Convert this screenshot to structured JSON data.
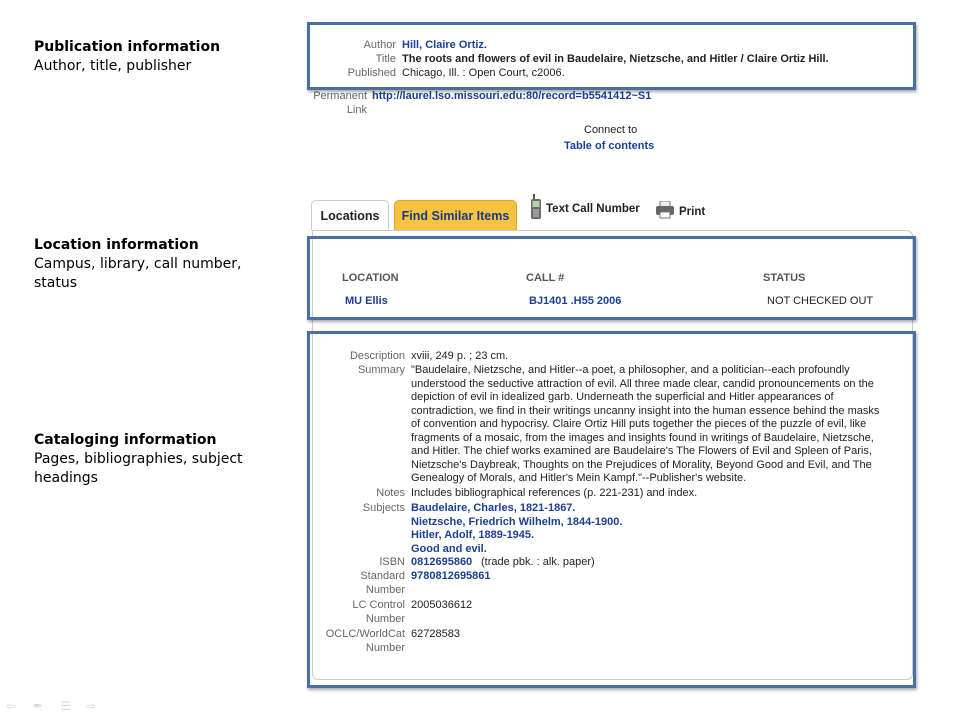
{
  "annotations": [
    {
      "heading": "Publication information",
      "text": "Author, title, publisher"
    },
    {
      "heading": "Location information",
      "text": "Campus, library, call number, status"
    },
    {
      "heading": "Cataloging information",
      "text": "Pages, bibliographies, subject headings"
    }
  ],
  "record": {
    "author_label": "Author",
    "author": "Hill, Claire Ortiz.",
    "title_label": "Title",
    "title": "The roots and flowers of evil in Baudelaire, Nietzsche, and Hitler / Claire Ortiz Hill.",
    "published_label": "Published",
    "published": "Chicago, Ill. : Open Court, c2006.",
    "permanent_label_1": "Permanent",
    "permanent_label_2": "Link",
    "permanent_link": "http://laurel.lso.missouri.edu:80/record=b5541412~S1",
    "connect_to": "Connect to",
    "toc_link": "Table of contents"
  },
  "tabs": {
    "locations": "Locations",
    "find_similar": "Find Similar Items",
    "text_call_number": "Text Call Number",
    "print": "Print"
  },
  "holdings": {
    "headers": [
      "LOCATION",
      "CALL #",
      "STATUS"
    ],
    "rows": [
      [
        "MU Ellis",
        "BJ1401 .H55 2006",
        "NOT CHECKED OUT"
      ]
    ]
  },
  "catalog": {
    "description_label": "Description",
    "description": "xviii, 249 p. ; 23 cm.",
    "summary_label": "Summary",
    "summary": "\"Baudelaire, Nietzsche, and Hitler--a poet, a philosopher, and a politician--each profoundly understood the seductive attraction of evil. All three made clear, candid pronouncements on the depiction of evil in idealized garb. Underneath the superficial and Hitler appearances of contradiction, we find in their writings uncanny insight into the human essence behind the masks of convention and hypocrisy. Claire Ortiz Hill puts together the pieces of the puzzle of evil, like fragments of a mosaic, from the images and insights found in writings of Baudelaire, Nietzsche, and Hitler. The chief works examined are Baudelaire's The Flowers of Evil and Spleen of Paris, Nietzsche's Daybreak, Thoughts on the Prejudices of Morality, Beyond Good and Evil, and The Genealogy of Morals, and Hitler's Mein Kampf.\"--Publisher's website.",
    "notes_label": "Notes",
    "notes": "Includes bibliographical references (p. 221-231) and index.",
    "subjects_label": "Subjects",
    "subjects": [
      "Baudelaire, Charles, 1821-1867.",
      "Nietzsche, Friedrich Wilhelm, 1844-1900.",
      "Hitler, Adolf, 1889-1945.",
      "Good and evil."
    ],
    "isbn_label": "ISBN",
    "isbn": "0812695860",
    "isbn_note": "(trade pbk. : alk. paper)",
    "std_label_1": "Standard",
    "std_label_2": "Number",
    "std_number": "9780812695861",
    "lc_label_1": "LC Control",
    "lc_label_2": "Number",
    "lc_number": "2005036612",
    "oclc_label_1": "OCLC/WorldCat",
    "oclc_label_2": "Number",
    "oclc_number": "62728583"
  },
  "colors": {
    "frame": "#4a6fa5",
    "link": "#1c3f94",
    "tab_highlight": "#f5c242"
  }
}
